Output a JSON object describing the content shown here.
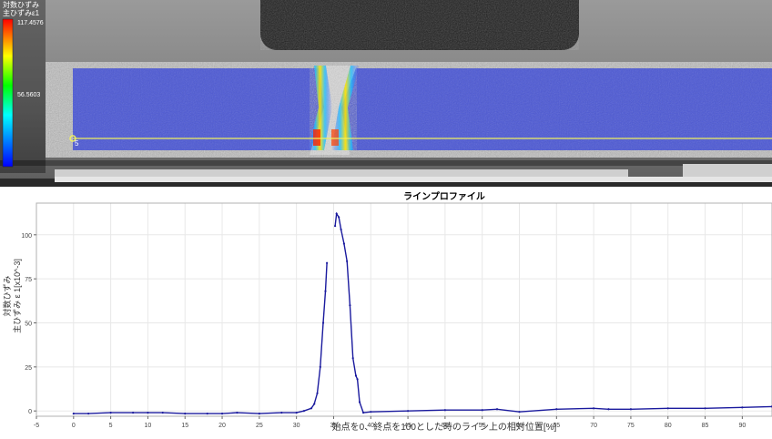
{
  "colorbar": {
    "title_line1": "対数ひずみ",
    "title_line2": "主ひずみε1",
    "max_label": "117.4576",
    "mid_label": "56.5603"
  },
  "overlay": {
    "point_label": "5"
  },
  "chart_data": {
    "type": "line",
    "title": "ラインプロファイル",
    "xlabel": "始点を0、終点を100とした時のライン上の相対位置[%]",
    "ylabel_line1": "対数ひずみ",
    "ylabel_line2": "主ひずみ ε 1[x10^-3]",
    "xlim": [
      -5,
      94
    ],
    "ylim": [
      -3,
      118
    ],
    "x_ticks": [
      -5,
      0,
      5,
      10,
      15,
      20,
      25,
      30,
      35,
      40,
      45,
      50,
      55,
      60,
      65,
      70,
      75,
      80,
      85,
      90
    ],
    "y_ticks": [
      0,
      25,
      50,
      75,
      100
    ],
    "grid": true,
    "series": [
      {
        "color": "#1a1a9e",
        "x": [
          0,
          2,
          5,
          8,
          10,
          12,
          15,
          18,
          20,
          22,
          25,
          28,
          30,
          31,
          32,
          32.4,
          32.8,
          33.2,
          33.6,
          33.9,
          34.1,
          34.4,
          34.8,
          35.2,
          35.4,
          35.7,
          36.0,
          36.4,
          36.8,
          37.2,
          37.6,
          38.0,
          38.2,
          38.5,
          39,
          40,
          45,
          50,
          55,
          57,
          60,
          65,
          70,
          72,
          75,
          80,
          85,
          90,
          94
        ],
        "y": [
          -1.5,
          -1.5,
          -1,
          -1,
          -1,
          -1,
          -1.5,
          -1.5,
          -1.5,
          -1,
          -1.5,
          -1,
          -1,
          0,
          1.5,
          4,
          10,
          25,
          50,
          68,
          84,
          null,
          null,
          105,
          112,
          110,
          103,
          95,
          85,
          60,
          30,
          20,
          18,
          5,
          -1,
          -0.5,
          0,
          0.5,
          0.5,
          1,
          -0.5,
          1,
          1.5,
          1,
          1,
          1.5,
          1.5,
          2,
          2.5
        ]
      }
    ]
  }
}
